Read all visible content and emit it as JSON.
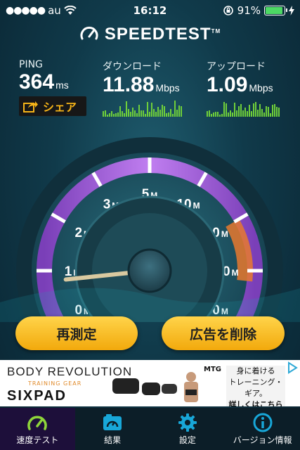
{
  "status_bar": {
    "carrier": "au",
    "time": "16:12",
    "battery": "91%",
    "battery_level": 0.91
  },
  "header": {
    "title": "SPEEDTEST",
    "trademark": "TM"
  },
  "stats": {
    "ping": {
      "label": "PING",
      "value": "364",
      "unit": "ms"
    },
    "download": {
      "label": "ダウンロード",
      "value": "11.88",
      "unit": "Mbps"
    },
    "upload": {
      "label": "アップロード",
      "value": "1.09",
      "unit": "Mbps"
    }
  },
  "share_label": "シェア",
  "gauge": {
    "ticks": [
      {
        "num": "0",
        "unit": "M"
      },
      {
        "num": "1",
        "unit": "M"
      },
      {
        "num": "2",
        "unit": "M"
      },
      {
        "num": "3",
        "unit": "M"
      },
      {
        "num": "5",
        "unit": "M"
      },
      {
        "num": "10",
        "unit": "M"
      },
      {
        "num": "20",
        "unit": "M"
      },
      {
        "num": "30",
        "unit": "M"
      },
      {
        "num": "50",
        "unit": "M"
      }
    ],
    "needle_tick_position": 0.1
  },
  "buttons": {
    "retest": "再測定",
    "remove_ads": "広告を削除"
  },
  "ad": {
    "headline": "BODY REVOLUTION",
    "subline": "TRAINING GEAR",
    "brand": "SIXPAD",
    "maker": "MTG",
    "copy_1": "身に着ける",
    "copy_2": "トレーニング・ギア。",
    "copy_3": "詳しくはこちら"
  },
  "tabs": [
    {
      "label": "速度テスト",
      "icon": "speedometer-icon",
      "active": true
    },
    {
      "label": "結果",
      "icon": "results-icon",
      "active": false
    },
    {
      "label": "設定",
      "icon": "gear-icon",
      "active": false
    },
    {
      "label": "バージョン情報",
      "icon": "info-icon",
      "active": false
    }
  ],
  "colors": {
    "accent": "#f6b418",
    "ring_purple": "#a35ad8",
    "upload_orange": "#e8792e",
    "graph_green": "#6fcf3a"
  }
}
